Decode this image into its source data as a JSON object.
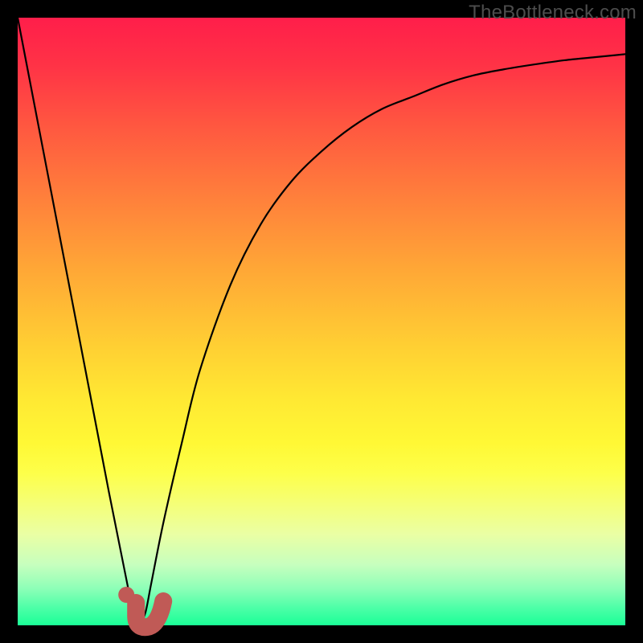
{
  "watermark": "TheBottleneck.com",
  "colors": {
    "curve": "#000000",
    "hook": "#c05a56",
    "dot": "#c05a56"
  },
  "chart_data": {
    "type": "line",
    "title": "",
    "xlabel": "",
    "ylabel": "",
    "xlim": [
      0,
      100
    ],
    "ylim": [
      0,
      100
    ],
    "series": [
      {
        "name": "bottleneck-curve",
        "x": [
          0,
          5,
          10,
          15,
          17,
          19,
          20,
          21,
          22,
          24,
          27,
          30,
          35,
          40,
          45,
          50,
          55,
          60,
          65,
          70,
          75,
          80,
          85,
          90,
          95,
          100
        ],
        "y": [
          100,
          74,
          48,
          22,
          12,
          2,
          0,
          2,
          7,
          17,
          30,
          42,
          56,
          66,
          73,
          78,
          82,
          85,
          87,
          89,
          90.5,
          91.5,
          92.3,
          93,
          93.5,
          94
        ]
      }
    ],
    "marker": {
      "name": "optimal-point-hook",
      "x": 20,
      "y": 0,
      "shape": "J-hook",
      "dot_offset": {
        "dx": -2.5,
        "dy": 3
      }
    }
  }
}
